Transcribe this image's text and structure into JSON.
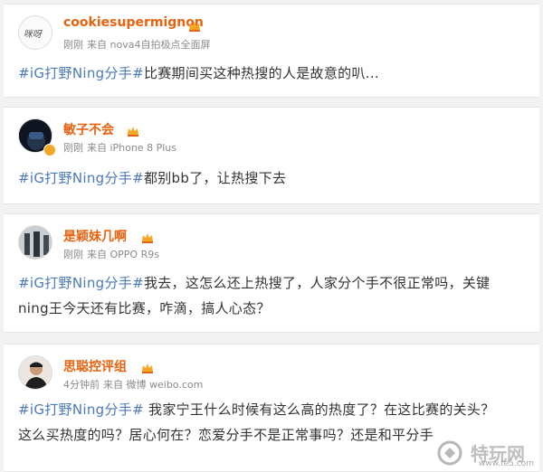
{
  "posts": [
    {
      "username": "cookiesupermignon",
      "time": "刚刚",
      "source": "来自 nova4自拍极点全面屏",
      "topic": "#iG打野Ning分手#",
      "body": "比赛期间买这种热搜的人是故意的叭...",
      "avatar_text": "咪呀"
    },
    {
      "username": "敏子不会",
      "time": "刚刚",
      "source": "来自 iPhone 8 Plus",
      "topic": "#iG打野Ning分手#",
      "body": "都别bb了，让热搜下去"
    },
    {
      "username": "是颖妹几啊",
      "time": "刚刚",
      "source": "来自 OPPO R9s",
      "topic": "#iG打野Ning分手#",
      "body_line1": "我去，这怎么还上热搜了，人家分个手不很正常吗，关键",
      "body_line2": "ning王今天还有比赛，咋滴，搞人心态？"
    },
    {
      "username": "思聪控评组",
      "time": "4分钟前",
      "source": "来自 微博 weibo.com",
      "topic": "#iG打野Ning分手#",
      "body_line1": " 我家宁王什么时候有这么高的热度了？在这比赛的关头？",
      "body_line2": "这么买热度的吗？居心何在？恋爱分手不是正常事吗？还是和平分手"
    }
  ],
  "watermark": {
    "text": "特玩网",
    "url": "www.te5.com"
  },
  "colors": {
    "username": "#e8620f",
    "topic": "#4a7ab7",
    "background": "#f2f2f2"
  }
}
